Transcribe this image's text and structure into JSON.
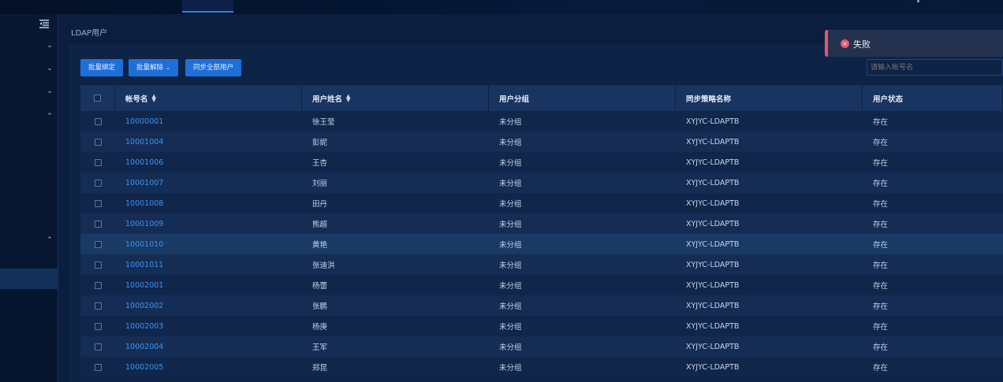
{
  "breadcrumb": "LDAP用户",
  "toolbar": {
    "bind_label": "批量绑定",
    "unbind_label": "批量解除",
    "sync_label": "同步全部用户"
  },
  "search": {
    "placeholder": "请输入帐号名"
  },
  "toast": {
    "message": "失败",
    "color": "#e15a6b"
  },
  "table": {
    "headers": [
      "帐号名",
      "用户姓名",
      "用户分组",
      "同步策略名称",
      "用户状态"
    ],
    "rows": [
      [
        "10000001",
        "徐王莹",
        "未分组",
        "XYJYC-LDAPTB",
        "存在"
      ],
      [
        "10001004",
        "彭妮",
        "未分组",
        "XYJYC-LDAPTB",
        "存在"
      ],
      [
        "10001006",
        "王杏",
        "未分组",
        "XYJYC-LDAPTB",
        "存在"
      ],
      [
        "10001007",
        "刘丽",
        "未分组",
        "XYJYC-LDAPTB",
        "存在"
      ],
      [
        "10001008",
        "田丹",
        "未分组",
        "XYJYC-LDAPTB",
        "存在"
      ],
      [
        "10001009",
        "熊超",
        "未分组",
        "XYJYC-LDAPTB",
        "存在"
      ],
      [
        "10001010",
        "黄艳",
        "未分组",
        "XYJYC-LDAPTB",
        "存在"
      ],
      [
        "10001011",
        "张迪洪",
        "未分组",
        "XYJYC-LDAPTB",
        "存在"
      ],
      [
        "10002001",
        "杨蕾",
        "未分组",
        "XYJYC-LDAPTB",
        "存在"
      ],
      [
        "10002002",
        "张鹏",
        "未分组",
        "XYJYC-LDAPTB",
        "存在"
      ],
      [
        "10002003",
        "杨庚",
        "未分组",
        "XYJYC-LDAPTB",
        "存在"
      ],
      [
        "10002004",
        "王军",
        "未分组",
        "XYJYC-LDAPTB",
        "存在"
      ],
      [
        "10002005",
        "郑昆",
        "未分组",
        "XYJYC-LDAPTB",
        "存在"
      ]
    ]
  },
  "colors": {
    "accent": "#1f6fd8",
    "link": "#3b92f0"
  }
}
